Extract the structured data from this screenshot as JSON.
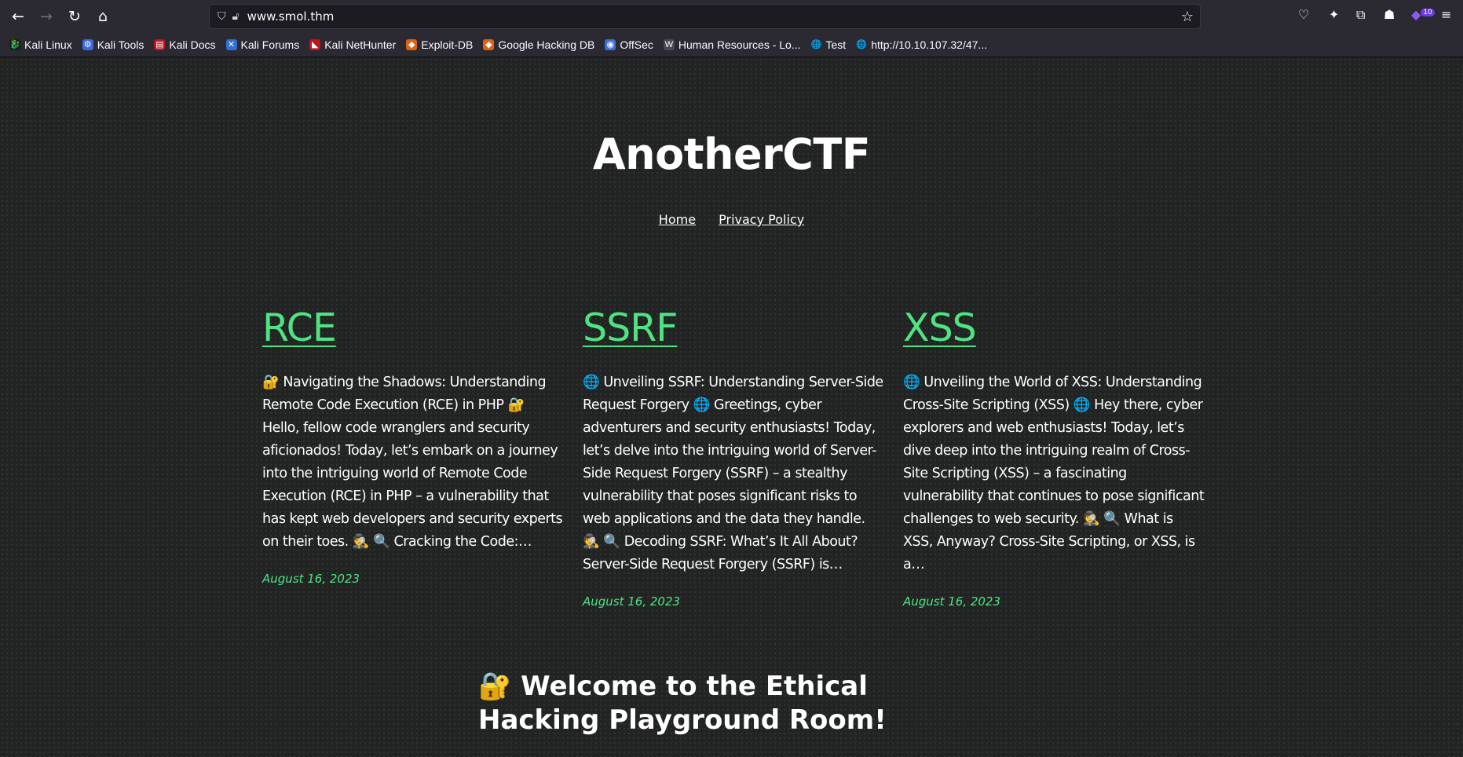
{
  "browser": {
    "url_host": "www.smol.thm",
    "bookmarks": [
      {
        "label": "Kali Linux",
        "color": "#1d1d1d",
        "glyph": "🐉"
      },
      {
        "label": "Kali Tools",
        "color": "#3c6ad8",
        "glyph": "⚙"
      },
      {
        "label": "Kali Docs",
        "color": "#c0131a",
        "glyph": "▤"
      },
      {
        "label": "Kali Forums",
        "color": "#2f6fd6",
        "glyph": "✕"
      },
      {
        "label": "Kali NetHunter",
        "color": "#c0131a",
        "glyph": "◣"
      },
      {
        "label": "Exploit-DB",
        "color": "#e0620f",
        "glyph": "◆"
      },
      {
        "label": "Google Hacking DB",
        "color": "#e0620f",
        "glyph": "◆"
      },
      {
        "label": "OffSec",
        "color": "#3e6fd8",
        "glyph": "◉"
      },
      {
        "label": "Human Resources - Lo...",
        "color": "#4a4a55",
        "glyph": "W"
      },
      {
        "label": "Test",
        "color": "transparent",
        "glyph": "🌐"
      },
      {
        "label": "http://10.10.107.32/47...",
        "color": "transparent",
        "glyph": "🌐"
      }
    ],
    "extension_badge": "10"
  },
  "site": {
    "title": "AnotherCTF",
    "nav": [
      "Home",
      "Privacy Policy"
    ]
  },
  "posts": [
    {
      "title": "RCE",
      "excerpt": "🔐 Navigating the Shadows: Understanding Remote Code Execution (RCE) in PHP 🔐 Hello, fellow code wranglers and security aficionados! Today, let’s embark on a journey into the intriguing world of Remote Code Execution (RCE) in PHP – a vulnerability that has kept web developers and security experts on their toes. 🕵️ 🔍 Cracking the Code:…",
      "date": "August 16, 2023"
    },
    {
      "title": "SSRF",
      "excerpt": "🌐 Unveiling SSRF: Understanding Server-Side Request Forgery 🌐 Greetings, cyber adventurers and security enthusiasts! Today, let’s delve into the intriguing world of Server-Side Request Forgery (SSRF) – a stealthy vulnerability that poses significant risks to web applications and the data they handle. 🕵️ 🔍 Decoding SSRF: What’s It All About? Server-Side Request Forgery (SSRF) is…",
      "date": "August 16, 2023"
    },
    {
      "title": "XSS",
      "excerpt": "🌐 Unveiling the World of XSS: Understanding Cross-Site Scripting (XSS) 🌐 Hey there, cyber explorers and web enthusiasts! Today, let’s dive deep into the intriguing realm of Cross-Site Scripting (XSS) – a fascinating vulnerability that continues to pose significant challenges to web security. 🕵️ 🔍 What is XSS, Anyway? Cross-Site Scripting, or XSS, is a…",
      "date": "August 16, 2023"
    }
  ],
  "welcome_heading": "🔐 Welcome to the Ethical Hacking Playground Room!"
}
